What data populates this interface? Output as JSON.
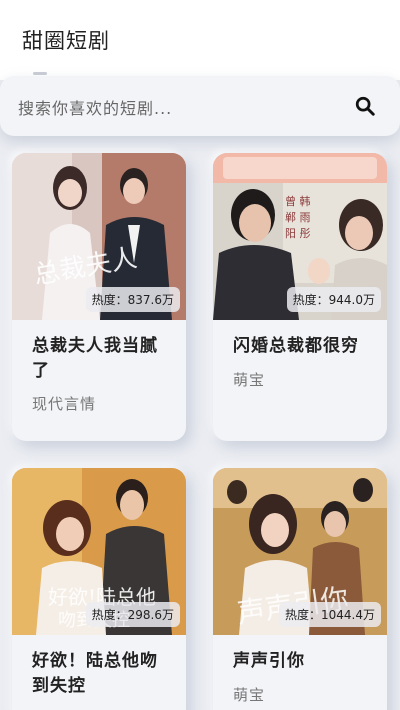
{
  "app": {
    "title": "甜圈短剧"
  },
  "search": {
    "placeholder": "搜索你喜欢的短剧..."
  },
  "dramas": [
    {
      "title": "总裁夫人我当腻了",
      "heat": "热度：837.6万",
      "tag": "现代言情"
    },
    {
      "title": "闪婚总裁都很穷",
      "heat": "热度：944.0万",
      "tag": "萌宝"
    },
    {
      "title": "好欲！陆总他吻到失控",
      "heat": "热度：298.6万",
      "tag": ""
    },
    {
      "title": "声声引你",
      "heat": "热度：1044.4万",
      "tag": "萌宝"
    }
  ],
  "colors": {
    "background": "#ebedf2",
    "card": "#f3f4f8",
    "accent": "#222222"
  }
}
